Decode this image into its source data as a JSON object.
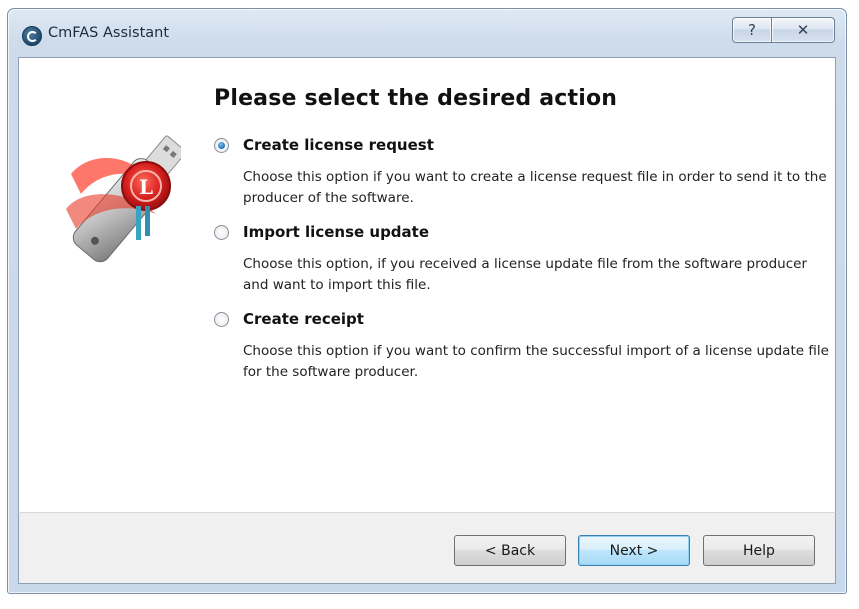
{
  "window": {
    "title": "CmFAS Assistant",
    "help_glyph": "?",
    "close_glyph": "✕"
  },
  "main": {
    "heading": "Please select the desired action",
    "options": [
      {
        "label": "Create license request",
        "description": "Choose this option if you want to create a license request file in order to send it to the producer of the software.",
        "selected": true
      },
      {
        "label": "Import license update",
        "description": "Choose this option, if you received a license update file from the software producer and want to import this file.",
        "selected": false
      },
      {
        "label": "Create receipt",
        "description": "Choose this option if you want to confirm the successful import of a license update file for the software producer.",
        "selected": false
      }
    ]
  },
  "footer": {
    "back_label": "< Back",
    "next_label": "Next >",
    "help_label": "Help"
  },
  "icons": {
    "app": "codemeter-icon",
    "illustration": "usb-license-key-icon"
  },
  "colors": {
    "accent": "#1d6db4",
    "seal_red": "#d82020",
    "titlebar": "#c9d8ea"
  }
}
